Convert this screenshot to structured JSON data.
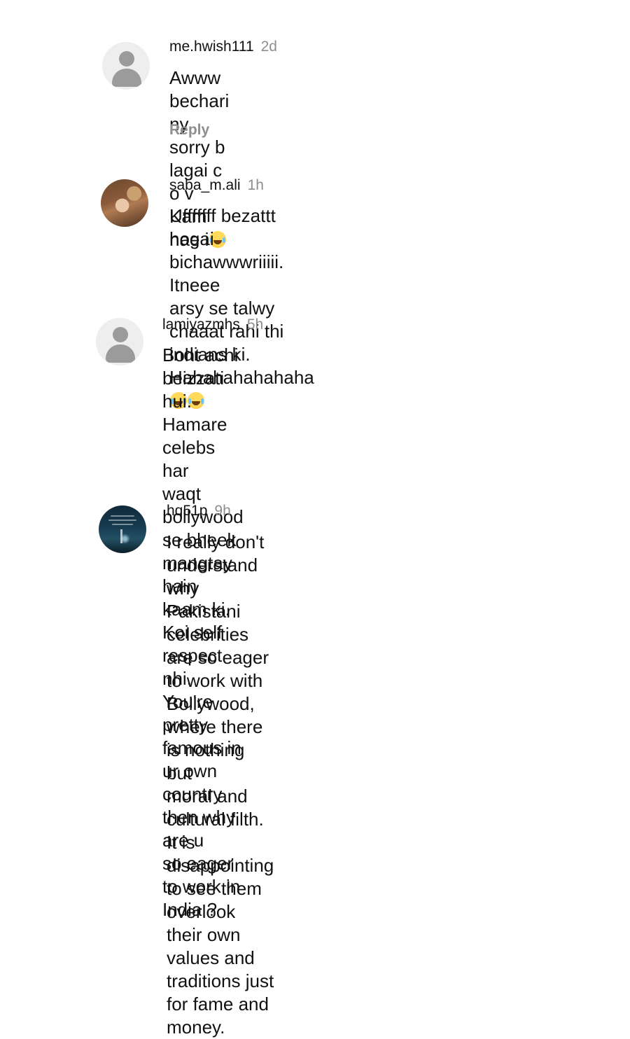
{
  "reply_label": "Reply",
  "emoji_name": "face-with-tears-of-joy",
  "comments": [
    {
      "username": "me.hwish111",
      "time": "2d",
      "text": "Awww bechari ny sorry b lagai c o v Kam\nnae i",
      "emoji_count": 1,
      "avatar": "default-user"
    },
    {
      "username": "saba_m.ali",
      "time": "1h",
      "text": "Ufffffff bezattt hogai bichawwwriiiii. Itneee\narsy se talwy chaaat rahi thi indians ki.\nHahahahahahaha",
      "emoji_count": 2,
      "avatar": "photo"
    },
    {
      "username": "lamiyazmhs",
      "time": "5h",
      "text": "Boht achi beizzati hui. Hamare celebs har\nwaqt bollywood se bheek mangtay hain\nkaam ki. Koi self respect nhi. You're pretty\nfamous in ur own country then why are u\nso eager to work in India ?",
      "emoji_count": 0,
      "avatar": "default-user"
    },
    {
      "username": "hq51p",
      "time": "9h",
      "text": "I really don't understand why Pakistani\ncelebrities are so eager to work with\nBollywood, where there is nothing but\nmoral and cultural filth. It is disappointing\nto see them overlook their own values and\ntraditions just for fame and money.",
      "emoji_count": 0,
      "avatar": "photo"
    }
  ]
}
